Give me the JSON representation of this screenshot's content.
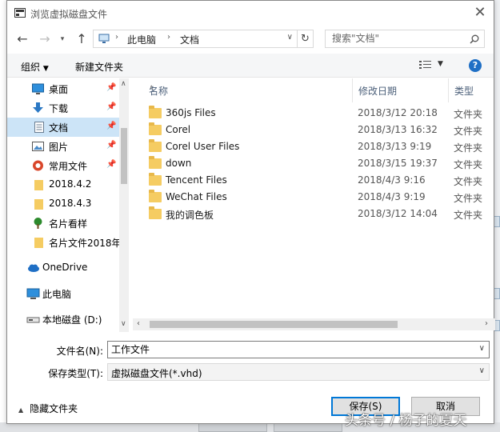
{
  "dialog": {
    "title": "浏览虚拟磁盘文件"
  },
  "address": {
    "crumbs": [
      "此电脑",
      "文档"
    ],
    "search_placeholder": "搜索\"文档\""
  },
  "toolbar": {
    "organize": "组织",
    "new_folder": "新建文件夹"
  },
  "nav": [
    {
      "label": "桌面",
      "icon": "desktop-icon",
      "pinned": true
    },
    {
      "label": "下载",
      "icon": "download-icon",
      "pinned": true
    },
    {
      "label": "文档",
      "icon": "document-icon",
      "pinned": true,
      "selected": true
    },
    {
      "label": "图片",
      "icon": "picture-icon",
      "pinned": true
    },
    {
      "label": "常用文件",
      "icon": "folder-red-icon",
      "pinned": true
    },
    {
      "label": "2018.4.2",
      "icon": "folder-icon"
    },
    {
      "label": "2018.4.3",
      "icon": "folder-icon"
    },
    {
      "label": "名片看样",
      "icon": "tree-icon"
    },
    {
      "label": "名片文件2018年",
      "icon": "folder-icon"
    },
    {
      "label": "OneDrive",
      "icon": "cloud-icon"
    },
    {
      "label": "此电脑",
      "icon": "computer-icon"
    },
    {
      "label": "本地磁盘 (D:)",
      "icon": "drive-icon"
    }
  ],
  "columns": {
    "name": "名称",
    "date": "修改日期",
    "type": "类型"
  },
  "files": [
    {
      "name": "360js Files",
      "date": "2018/3/12 20:18",
      "type": "文件夹"
    },
    {
      "name": "Corel",
      "date": "2018/3/13 16:32",
      "type": "文件夹"
    },
    {
      "name": "Corel User Files",
      "date": "2018/3/13 9:19",
      "type": "文件夹"
    },
    {
      "name": "down",
      "date": "2018/3/15 19:37",
      "type": "文件夹"
    },
    {
      "name": "Tencent Files",
      "date": "2018/4/3 9:16",
      "type": "文件夹"
    },
    {
      "name": "WeChat Files",
      "date": "2018/4/3 9:19",
      "type": "文件夹"
    },
    {
      "name": "我的调色板",
      "date": "2018/3/12 14:04",
      "type": "文件夹"
    }
  ],
  "footer": {
    "filename_label": "文件名(N):",
    "filename_value": "工作文件",
    "filetype_label": "保存类型(T):",
    "filetype_value": "虚拟磁盘文件(*.vhd)",
    "hide_folders": "隐藏文件夹",
    "save": "保存(S)",
    "cancel": "取消"
  },
  "watermark": "头条号 / 杨子的夏天",
  "colors": {
    "selection": "#cce4f7",
    "accent": "#0078d7",
    "folder": "#f5cc62"
  }
}
